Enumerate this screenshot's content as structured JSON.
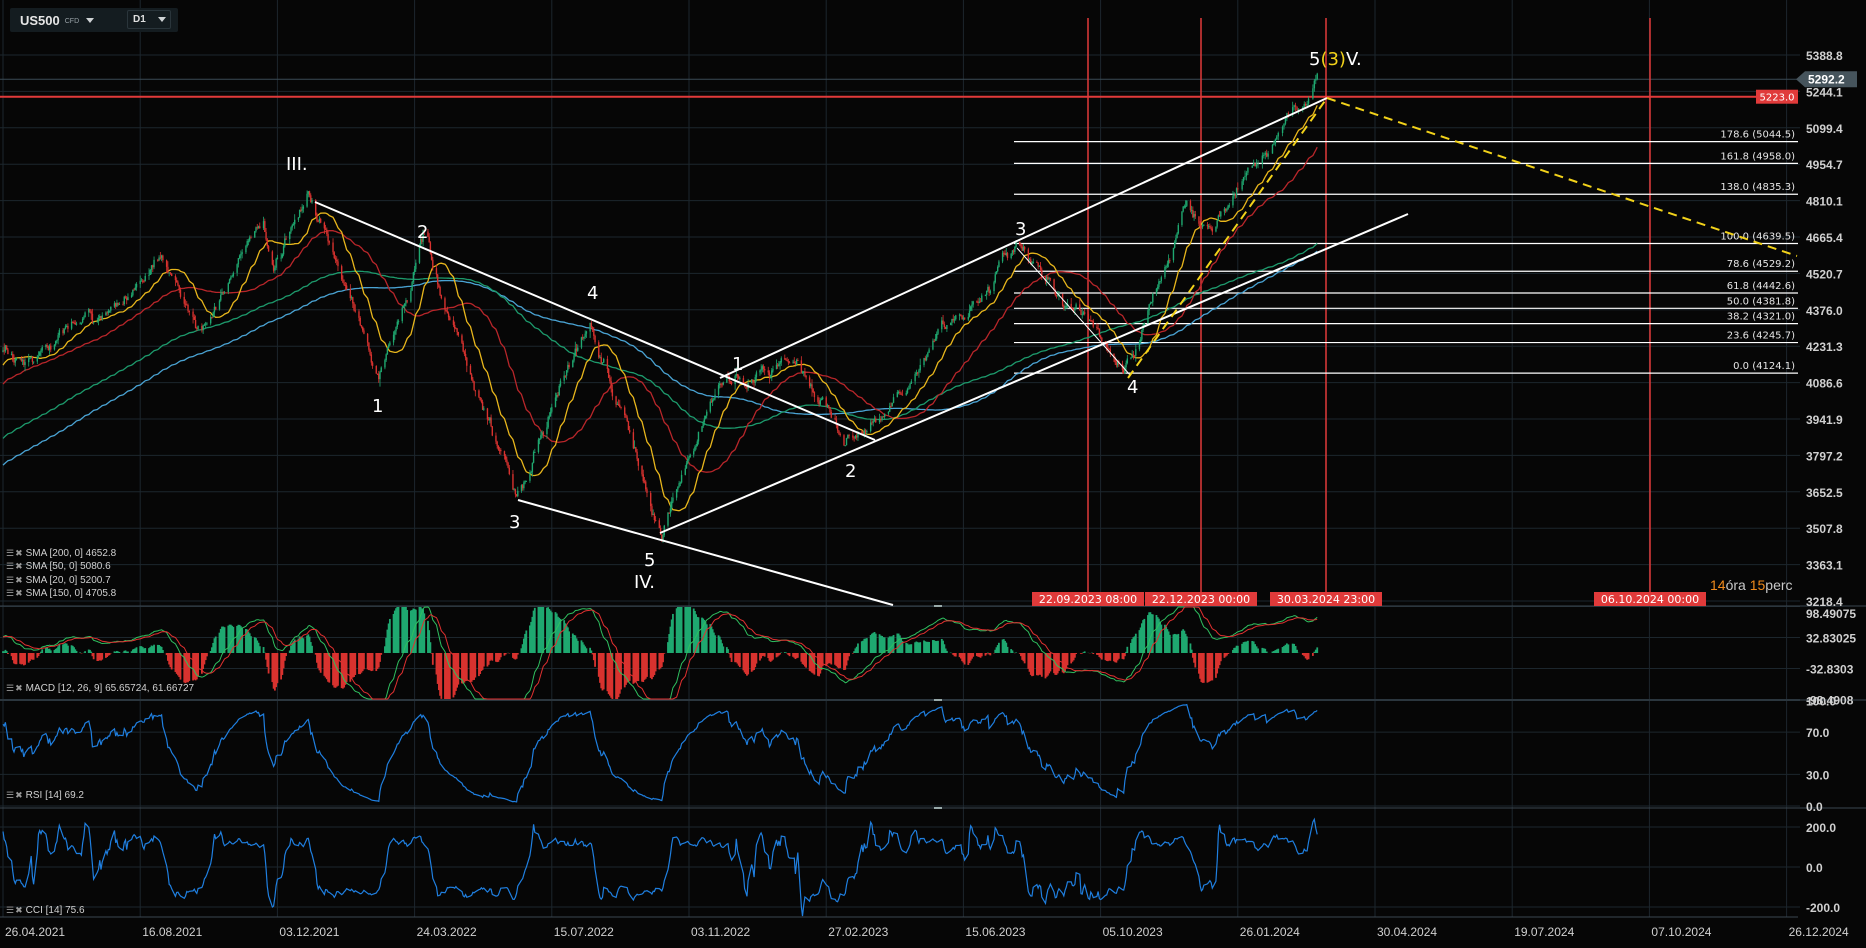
{
  "header": {
    "symbol": "US500",
    "instrument_type": "CFD",
    "timeframe": "D1"
  },
  "legends": {
    "sma200": "SMA [200,  0] 4652.8",
    "sma50": "SMA [50,  0] 5080.6",
    "sma20": "SMA [20,  0] 5200.7",
    "sma150": "SMA [150,  0] 4705.8",
    "macd": "MACD [12,  26,  9] 65.65724,  61.66727",
    "rsi": "RSI [14] 69.2",
    "cci": "CCI [14] 75.6",
    "icon_settings": "☰",
    "icon_close": "✖"
  },
  "timer": {
    "hours": "14",
    "hours_unit": "óra",
    "minutes": "15",
    "minutes_unit": "perc"
  },
  "price_tags": {
    "current": "5292.2",
    "current_value": 5292.2,
    "hline": "5223.0",
    "hline_value": 5223.0
  },
  "date_markers": [
    "22.09.2023 08:00",
    "22.12.2023 00:00",
    "30.03.2024 23:00",
    "06.10.2024 00:00"
  ],
  "waves": {
    "labels": [
      "III.",
      "1",
      "2",
      "3",
      "4",
      "5",
      "IV.",
      "1",
      "2",
      "3",
      "4"
    ],
    "top_prefix": "5",
    "top_mid": "(3)",
    "top_suffix": "V."
  },
  "fib_levels": [
    {
      "label": "178.6 (5044.5)",
      "price": 5044.5
    },
    {
      "label": "161.8 (4958.0)",
      "price": 4958.0
    },
    {
      "label": "138.0 (4835.3)",
      "price": 4835.3
    },
    {
      "label": "100.0 (4639.5)",
      "price": 4639.5
    },
    {
      "label": "78.6 (4529.2)",
      "price": 4529.2
    },
    {
      "label": "61.8 (4442.6)",
      "price": 4442.6
    },
    {
      "label": "50.0 (4381.8)",
      "price": 4381.8
    },
    {
      "label": "38.2 (4321.0)",
      "price": 4321.0
    },
    {
      "label": "23.6 (4245.7)",
      "price": 4245.7
    },
    {
      "label": "0.0 (4124.1)",
      "price": 4124.1
    }
  ],
  "colors": {
    "up": "#1fa870",
    "down": "#d8322f",
    "sma20": "#e8b61c",
    "sma50": "#b8262a",
    "sma150": "#1d9a6c",
    "sma200": "#4aa3d3",
    "osc": "#1f7fe0",
    "marker": "#e03a3a",
    "fib": "#ffffff",
    "dash": "#f2d21a"
  },
  "chart_data": {
    "type": "candlestick",
    "title": "US500 CFD D1",
    "x_ticks": [
      "26.04.2021",
      "16.08.2021",
      "03.12.2021",
      "24.03.2022",
      "15.07.2022",
      "03.11.2022",
      "27.02.2023",
      "15.06.2023",
      "05.10.2023",
      "26.01.2024",
      "30.04.2024",
      "19.07.2024",
      "07.10.2024",
      "26.12.2024"
    ],
    "y_ticks": [
      "5388.8",
      "5244.1",
      "5099.4",
      "4954.7",
      "4810.1",
      "4665.4",
      "4520.7",
      "4376.0",
      "4231.3",
      "4086.6",
      "3941.9",
      "3797.2",
      "3652.5",
      "3507.8",
      "3363.1",
      "3218.4"
    ],
    "ylim": [
      3218.4,
      5388.8
    ],
    "price_path": [
      [
        "26.04.2021",
        4185
      ],
      [
        "15.06.2021",
        4250
      ],
      [
        "02.09.2021",
        4540
      ],
      [
        "04.10.2021",
        4300
      ],
      [
        "22.11.2021",
        4710
      ],
      [
        "01.12.2021",
        4520
      ],
      [
        "31.12.2021",
        4794
      ],
      [
        "23.02.2022",
        4100
      ],
      [
        "31.03.2022",
        4630
      ],
      [
        "16.06.2022",
        3636
      ],
      [
        "15.08.2022",
        4310
      ],
      [
        "12.10.2022",
        3492
      ],
      [
        "01.12.2022",
        4107
      ],
      [
        "02.02.2023",
        4190
      ],
      [
        "14.03.2023",
        3813
      ],
      [
        "28.07.2023",
        4620
      ],
      [
        "29.10.2023",
        4119
      ],
      [
        "15.12.2023",
        4800
      ],
      [
        "05.01.2024",
        4690
      ],
      [
        "21.03.2024",
        5292
      ]
    ],
    "macd_panel": {
      "ticks": [
        "98.49075",
        "32.83025",
        "-32.8303",
        "-98.4908"
      ],
      "ylim": [
        -98.4908,
        98.49075
      ]
    },
    "rsi_panel": {
      "ticks": [
        "100.0",
        "70.0",
        "30.0",
        "0.0"
      ],
      "ylim": [
        0,
        100
      ]
    },
    "cci_panel": {
      "ticks": [
        "200.0",
        "0.0",
        "-200.0"
      ],
      "ylim": [
        -200,
        200
      ]
    }
  }
}
